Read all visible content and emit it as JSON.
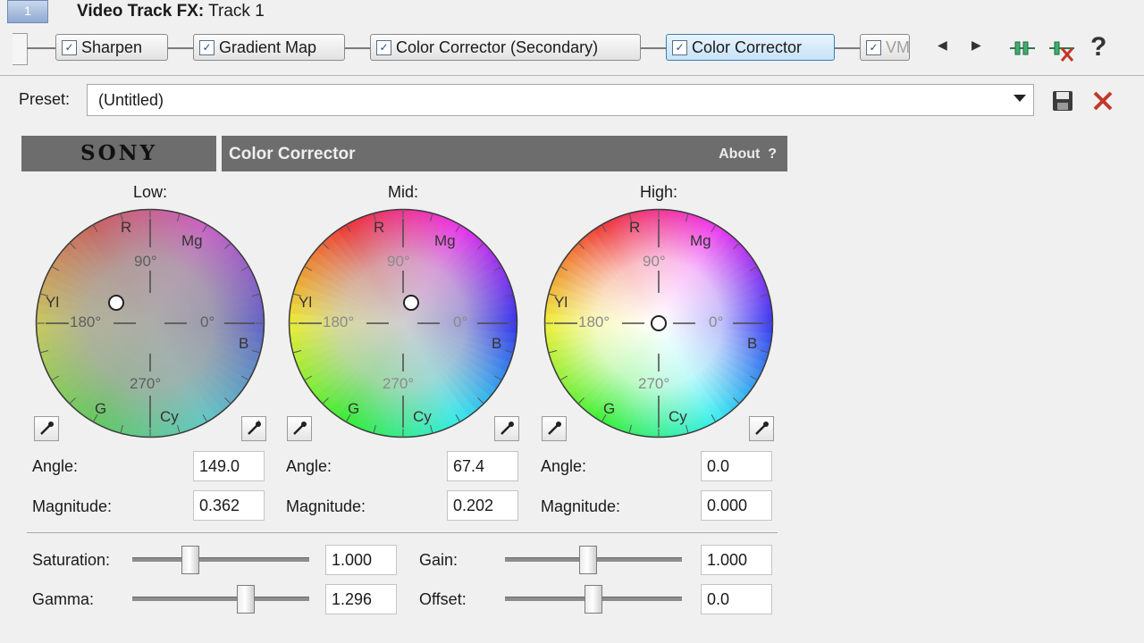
{
  "window": {
    "track_number": "1",
    "title_bold": "Video Track FX:",
    "title_rest": " Track 1"
  },
  "fx_chain": [
    {
      "label": "Sharpen",
      "checked": true
    },
    {
      "label": "Gradient Map",
      "checked": true
    },
    {
      "label": "Color Corrector (Secondary)",
      "checked": true
    },
    {
      "label": "Color Corrector",
      "checked": true,
      "active": true
    },
    {
      "label": "VM",
      "checked": true
    }
  ],
  "toolbar": {
    "help_label": "?"
  },
  "preset": {
    "label": "Preset:",
    "value": "(Untitled)"
  },
  "header": {
    "brand": "SONY",
    "plugin_name": "Color Corrector",
    "about_label": "About",
    "about_help": "?"
  },
  "wheels": [
    {
      "title": "Low:",
      "labels": {
        "r": "R",
        "mg": "Mg",
        "yl": "Yl",
        "b": "B",
        "g": "G",
        "cy": "Cy"
      },
      "degrees": {
        "d90": "90°",
        "d180": "180°",
        "d0": "0°",
        "d270": "270°"
      },
      "angle_label": "Angle:",
      "angle": "149.0",
      "magnitude_label": "Magnitude:",
      "magnitude": "0.362"
    },
    {
      "title": "Mid:",
      "labels": {
        "r": "R",
        "mg": "Mg",
        "yl": "Yl",
        "b": "B",
        "g": "G",
        "cy": "Cy"
      },
      "degrees": {
        "d90": "90°",
        "d180": "180°",
        "d0": "0°",
        "d270": "270°"
      },
      "angle_label": "Angle:",
      "angle": "67.4",
      "magnitude_label": "Magnitude:",
      "magnitude": "0.202"
    },
    {
      "title": "High:",
      "labels": {
        "r": "R",
        "mg": "Mg",
        "yl": "Yl",
        "b": "B",
        "g": "G",
        "cy": "Cy"
      },
      "degrees": {
        "d90": "90°",
        "d180": "180°",
        "d0": "0°",
        "d270": "270°"
      },
      "angle_label": "Angle:",
      "angle": "0.0",
      "magnitude_label": "Magnitude:",
      "magnitude": "0.000"
    }
  ],
  "sliders": {
    "saturation": {
      "label": "Saturation:",
      "value": "1.000",
      "level": 0.33
    },
    "gamma": {
      "label": "Gamma:",
      "value": "1.296",
      "level": 0.64
    },
    "gain": {
      "label": "Gain:",
      "value": "1.000",
      "level": 0.47
    },
    "offset": {
      "label": "Offset:",
      "value": "0.0",
      "level": 0.5
    }
  },
  "colors": {
    "active_fx": "#c6e2f7",
    "header_band": "#6d6d6d",
    "delete_icon": "#c0392b"
  },
  "icons": [
    "checkbox-icon",
    "arrow-left-icon",
    "arrow-right-icon",
    "plugin-chain-icon",
    "remove-plugin-icon",
    "help-icon",
    "dropdown-icon",
    "save-icon",
    "delete-icon",
    "eyedropper-icon"
  ]
}
